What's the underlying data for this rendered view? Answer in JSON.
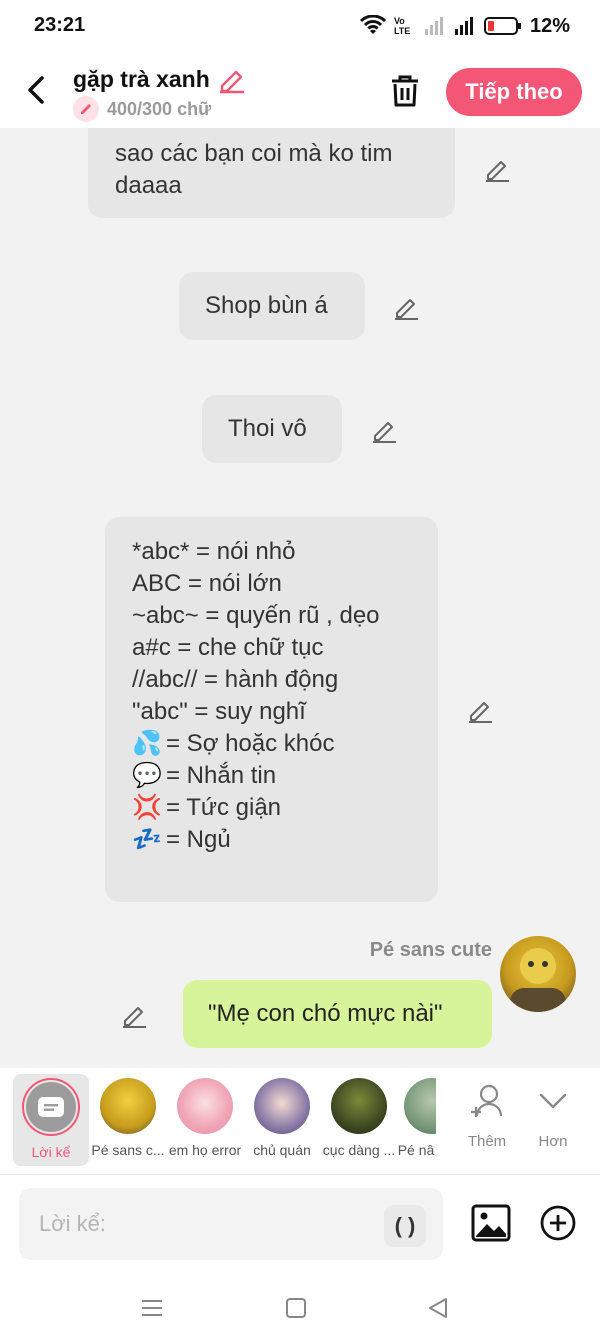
{
  "status_bar": {
    "time": "23:21",
    "battery": "12%",
    "lte_label": "Vo LTE"
  },
  "header": {
    "title": "gặp trà xanh",
    "word_count": "400/300 chữ",
    "next_button": "Tiếp theo"
  },
  "messages": [
    {
      "text": "sao các bạn coi mà ko tim daaaa"
    },
    {
      "text": "Shop bùn á"
    },
    {
      "text": "Thoi vô"
    },
    {
      "lines": [
        "*abc* = nói nhỏ",
        "ABC = nói lớn",
        "~abc~ = quyến rũ , dẹo",
        "a#c = che chữ tục",
        "//abc// = hành động",
        "\"abc\" = suy nghĩ"
      ],
      "emoji_lines": [
        {
          "emoji": "💦",
          "text": "= Sợ hoặc khóc"
        },
        {
          "emoji": "💬",
          "text": "= Nhắn tin"
        },
        {
          "emoji": "💢",
          "text": "= Tức giận"
        },
        {
          "emoji": "💤",
          "text": "= Ngủ"
        }
      ]
    }
  ],
  "sent_message": {
    "sender": "Pé sans cute",
    "text": "\"Mẹ con chó mực nài\""
  },
  "characters": [
    {
      "label": "Lời kể",
      "selected": true
    },
    {
      "label": "Pé sans c..."
    },
    {
      "label": "em họ error"
    },
    {
      "label": "chủ quán"
    },
    {
      "label": "cục dàng ..."
    },
    {
      "label": "Pé nâ"
    }
  ],
  "more_actions": {
    "add_label": "Thêm",
    "more_label": "Hơn"
  },
  "input": {
    "placeholder": "Lời kể:",
    "paren_label": "( )"
  },
  "colors": {
    "accent": "#f45776",
    "bubble_gray": "#e6e6e6",
    "bubble_green": "#d8f49a"
  }
}
